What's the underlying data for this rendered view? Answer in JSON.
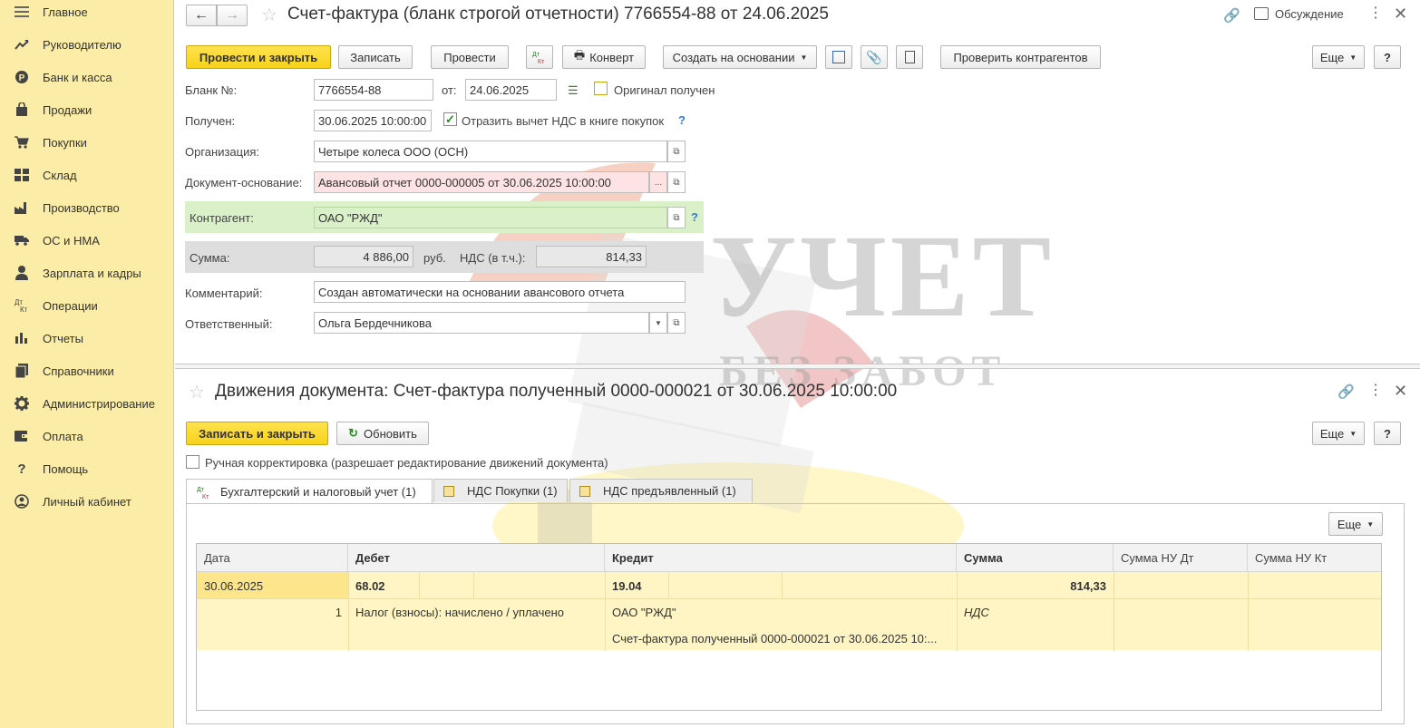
{
  "sidebar": {
    "items": [
      {
        "label": "Главное",
        "icon": "menu-icon"
      },
      {
        "label": "Руководителю",
        "icon": "trend-icon"
      },
      {
        "label": "Банк и касса",
        "icon": "coin-icon"
      },
      {
        "label": "Продажи",
        "icon": "bag-icon"
      },
      {
        "label": "Покупки",
        "icon": "cart-icon"
      },
      {
        "label": "Склад",
        "icon": "warehouse-icon"
      },
      {
        "label": "Производство",
        "icon": "factory-icon"
      },
      {
        "label": "ОС и НМА",
        "icon": "truck-icon"
      },
      {
        "label": "Зарплата и кадры",
        "icon": "person-icon"
      },
      {
        "label": "Операции",
        "icon": "dt-kt-icon"
      },
      {
        "label": "Отчеты",
        "icon": "bar-chart-icon"
      },
      {
        "label": "Справочники",
        "icon": "books-icon"
      },
      {
        "label": "Администрирование",
        "icon": "gear-icon"
      },
      {
        "label": "Оплата",
        "icon": "wallet-icon"
      },
      {
        "label": "Помощь",
        "icon": "question-icon"
      },
      {
        "label": "Личный кабинет",
        "icon": "user-circle-icon"
      }
    ]
  },
  "doc": {
    "title": "Счет-фактура (бланк строгой отчетности) 7766554-88 от 24.06.2025",
    "discussion": "Обсуждение",
    "toolbar": {
      "post_close": "Провести и закрыть",
      "save": "Записать",
      "post": "Провести",
      "envelope": "Конверт",
      "create_based": "Создать на основании",
      "check_contractors": "Проверить контрагентов",
      "more": "Еще",
      "help": "?"
    },
    "form": {
      "blank_label": "Бланк №:",
      "blank_value": "7766554-88",
      "from_label": "от:",
      "from_value": "24.06.2025",
      "original_label": "Оригинал получен",
      "received_label": "Получен:",
      "received_value": "30.06.2025 10:00:00",
      "vat_deduction_label": "Отразить вычет НДС в книге покупок",
      "org_label": "Организация:",
      "org_value": "Четыре колеса ООО (ОСН)",
      "basis_label": "Документ-основание:",
      "basis_value": "Авансовый отчет 0000-000005 от 30.06.2025 10:00:00",
      "contractor_label": "Контрагент:",
      "contractor_value": "ОАО \"РЖД\"",
      "sum_label": "Сумма:",
      "sum_value": "4 886,00",
      "currency": "руб.",
      "vat_label": "НДС (в т.ч.):",
      "vat_value": "814,33",
      "comment_label": "Комментарий:",
      "comment_value": "Создан автоматически на основании авансового отчета",
      "responsible_label": "Ответственный:",
      "responsible_value": "Ольга Бердечникова",
      "help_mark": "?"
    }
  },
  "movements": {
    "title": "Движения документа: Счет-фактура полученный 0000-000021 от 30.06.2025 10:00:00",
    "save_close": "Записать и закрыть",
    "refresh": "Обновить",
    "more": "Еще",
    "help": "?",
    "manual_label": "Ручная корректировка (разрешает редактирование движений документа)",
    "tabs": [
      "Бухгалтерский и налоговый учет (1)",
      "НДС Покупки (1)",
      "НДС предъявленный (1)"
    ],
    "grid_more": "Еще",
    "columns": [
      "Дата",
      "Дебет",
      "Кредит",
      "Сумма",
      "Сумма НУ Дт",
      "Сумма НУ Кт"
    ],
    "row": {
      "date": "30.06.2025",
      "num": "1",
      "debit": "68.02",
      "debit_sub": "Налог (взносы): начислено / уплачено",
      "credit": "19.04",
      "credit_sub1": "ОАО \"РЖД\"",
      "credit_sub2": "Счет-фактура полученный 0000-000021 от 30.06.2025 10:...",
      "sum": "814,33",
      "sum_sub": "НДС"
    }
  },
  "watermark": {
    "line1": "УЧЕТ",
    "line2": "БЕЗ ЗАБОТ"
  },
  "colors": {
    "sidebar_bg": "#fbeda7",
    "accent_yellow": "#f7d21a",
    "contractor_bg": "#d9f0c8",
    "row_bg": "#fff5c4"
  }
}
